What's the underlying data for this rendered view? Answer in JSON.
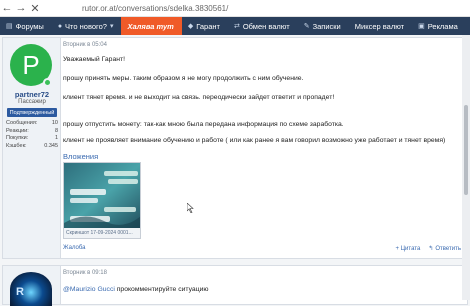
{
  "browser": {
    "url": "rutor.or.at/conversations/sdelka.3830561/"
  },
  "nav": {
    "items": [
      {
        "label": "Форумы",
        "icon": "chat-icon"
      },
      {
        "label": "Что нового?",
        "icon": "bell-icon"
      },
      {
        "label": "Халява тут",
        "icon": ""
      },
      {
        "label": "Гарант",
        "icon": "shield-icon"
      },
      {
        "label": "Обмен валют",
        "icon": "exchange-icon"
      },
      {
        "label": "Записки",
        "icon": "notes-icon"
      },
      {
        "label": "Миксер валют",
        "icon": "mixer-icon"
      },
      {
        "label": "Реклама",
        "icon": "ad-icon"
      }
    ],
    "accent_color": "#f05a28",
    "bar_color": "#2a3f5c"
  },
  "post1": {
    "user": {
      "avatar_letter": "P",
      "name": "partner72",
      "role": "Пассажир",
      "badge": "Подтвержденный",
      "stats": [
        {
          "label": "Сообщения:",
          "value": "10"
        },
        {
          "label": "Реакции:",
          "value": "8"
        },
        {
          "label": "Покупки:",
          "value": "1"
        },
        {
          "label": "Кэшбек:",
          "value": "0.345"
        }
      ]
    },
    "meta": "Вторник в 05:04",
    "lines": [
      "Уважаемый Гарант!",
      "прошу принять меры. таким образом я не могу продолжить с ним обучение.",
      "клиент тянет время. и не выходит на связь. переодически зайдет ответит и пропадет!",
      "прошу отпустить монету: так-как мною была передана информация по схеме заработка.",
      "клиент не проявляет внимание обучению и работе ( или как ранее я вам говорил возможно уже работает и тянет время)"
    ],
    "attachments_title": "Вложения",
    "attachment_caption": "Скриншот 17-09-2024 0001...",
    "footer": {
      "complaint": "Жалоба",
      "quote": "+ Цитата",
      "reply": "Ответить"
    }
  },
  "post2": {
    "meta": "Вторник в 09:18",
    "mention": "@Maurizio Gucci",
    "text": " прокомментируйте ситуацию"
  }
}
